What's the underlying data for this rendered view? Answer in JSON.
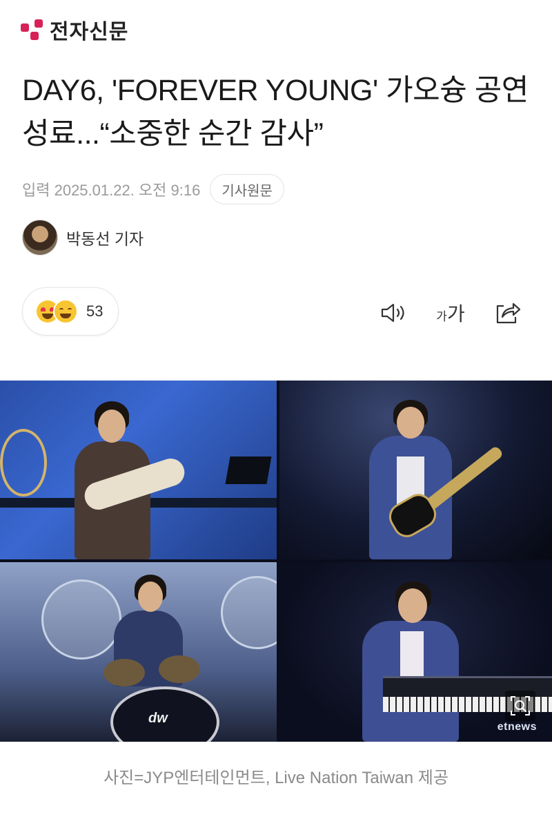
{
  "brand": {
    "name": "전자신문",
    "accent_color": "#d62258"
  },
  "article": {
    "headline": "DAY6, 'FOREVER YOUNG' 가오슝 공연 성료...“소중한 순간 감사”",
    "published": "입력 2025.01.22. 오전 9:16",
    "original_article_label": "기사원문",
    "author": "박동선 기자"
  },
  "reactions": {
    "icons": [
      "heart-eyes-emoji-icon",
      "smile-emoji-icon"
    ],
    "count": "53"
  },
  "toolbar": {
    "icons": [
      "speaker-icon",
      "font-size-icon",
      "share-icon"
    ],
    "font_size_small": "가",
    "font_size_large": "가"
  },
  "photo": {
    "watermark": "etnews",
    "zoom_icon": "zoom-icon",
    "caption": "사진=JYP엔터테인먼트, Live Nation Taiwan 제공"
  }
}
